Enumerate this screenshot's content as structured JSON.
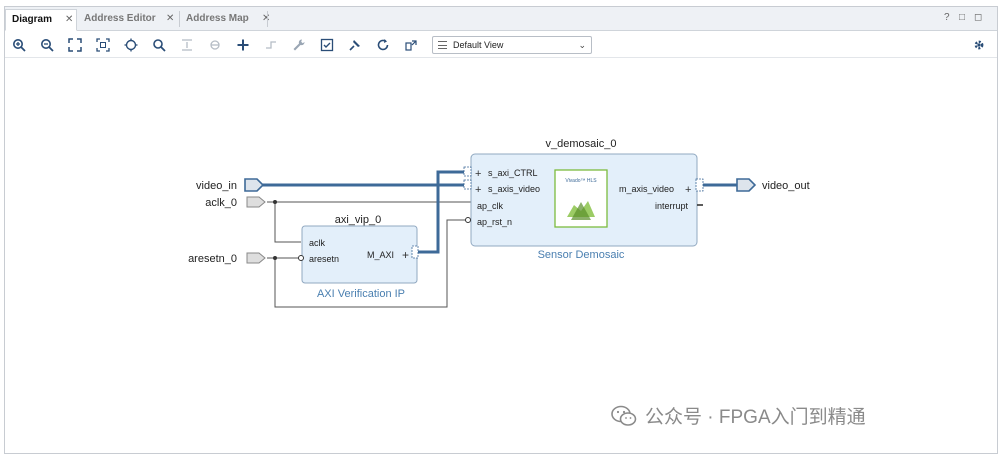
{
  "tabs": [
    {
      "label": "Diagram",
      "active": true
    },
    {
      "label": "Address Editor",
      "active": false
    },
    {
      "label": "Address Map",
      "active": false
    }
  ],
  "window_controls": {
    "help": "?",
    "restore": "□",
    "maximize": "◻"
  },
  "toolbar": {
    "view_select_value": "Default View"
  },
  "diagram": {
    "ports_in": [
      "video_in",
      "aclk_0",
      "aresetn_0"
    ],
    "ports_out": [
      "video_out"
    ],
    "blocks": {
      "demosaic": {
        "instance": "v_demosaic_0",
        "subtitle": "Sensor Demosaic",
        "left_pins": [
          "s_axi_CTRL",
          "s_axis_video",
          "ap_clk",
          "ap_rst_n"
        ],
        "right_pins": [
          "m_axis_video",
          "interrupt"
        ],
        "logo_text": "Vivado™ HLS"
      },
      "axi_vip": {
        "instance": "axi_vip_0",
        "subtitle": "AXI Verification IP",
        "left_pins": [
          "aclk",
          "aresetn"
        ],
        "right_pins": [
          "M_AXI"
        ]
      }
    }
  },
  "watermark": {
    "text": "公众号 · FPGA入门到精通"
  },
  "colors": {
    "bus": "#3e6a98",
    "block_fill": "#e3effa",
    "block_border": "#90a8c0",
    "subtitle": "#4a7fb0"
  }
}
